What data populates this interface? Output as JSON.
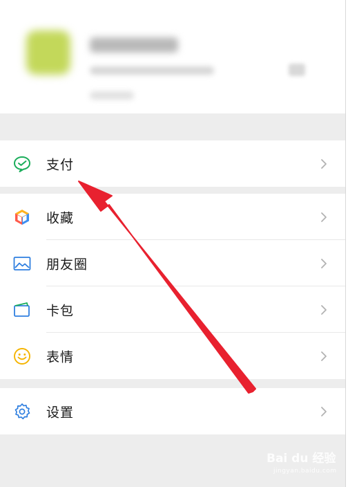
{
  "menu": {
    "pay": {
      "label": "支付",
      "icon": "wechat-pay-icon"
    },
    "favorites": {
      "label": "收藏",
      "icon": "favorites-cube-icon"
    },
    "moments": {
      "label": "朋友圈",
      "icon": "moments-picture-icon"
    },
    "cards": {
      "label": "卡包",
      "icon": "card-wallet-icon"
    },
    "stickers": {
      "label": "表情",
      "icon": "smiley-icon"
    },
    "settings": {
      "label": "设置",
      "icon": "settings-gear-icon"
    }
  },
  "watermark": {
    "text": "Bai du 经验",
    "subtext": "jingyan.baidu.com"
  },
  "colors": {
    "accent_green": "#1aad5a",
    "annotation_arrow": "#e8212f",
    "background": "#ededed"
  }
}
